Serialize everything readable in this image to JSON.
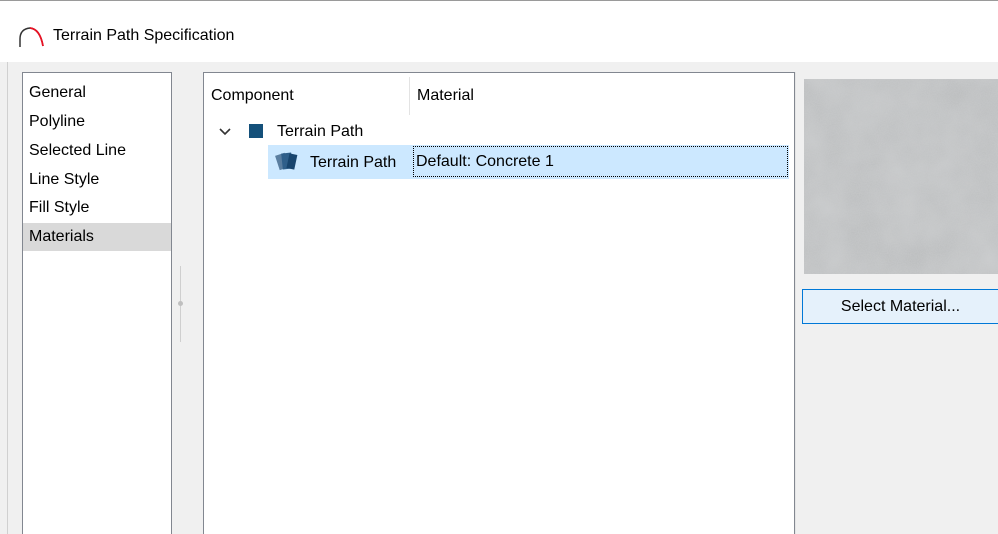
{
  "window": {
    "title": "Terrain Path Specification",
    "icon": "arc-tool-icon",
    "accent_color": "#e81123"
  },
  "nav": {
    "items": [
      {
        "label": "General",
        "selected": false
      },
      {
        "label": "Polyline",
        "selected": false
      },
      {
        "label": "Selected Line",
        "selected": false
      },
      {
        "label": "Line Style",
        "selected": false
      },
      {
        "label": "Fill Style",
        "selected": false
      },
      {
        "label": "Materials",
        "selected": true
      }
    ]
  },
  "tree": {
    "columns": [
      "Component",
      "Material"
    ],
    "parent": {
      "label": "Terrain Path",
      "expanded": true,
      "icon": "blue-square-icon",
      "color": "#14507a"
    },
    "child": {
      "label": "Terrain Path",
      "material": "Default: Concrete 1",
      "icon": "material-swatch-icon",
      "selected": true
    }
  },
  "preview": {
    "description": "concrete-texture",
    "base_color": "#b7b9ba"
  },
  "buttons": {
    "select_material": "Select Material..."
  }
}
